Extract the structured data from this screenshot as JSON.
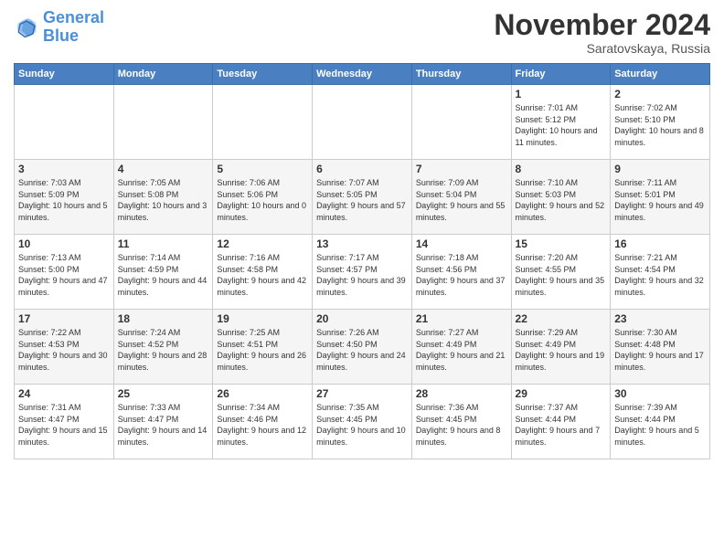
{
  "header": {
    "logo_line1": "General",
    "logo_line2": "Blue",
    "month": "November 2024",
    "location": "Saratovskaya, Russia"
  },
  "weekdays": [
    "Sunday",
    "Monday",
    "Tuesday",
    "Wednesday",
    "Thursday",
    "Friday",
    "Saturday"
  ],
  "weeks": [
    [
      {
        "day": "",
        "info": ""
      },
      {
        "day": "",
        "info": ""
      },
      {
        "day": "",
        "info": ""
      },
      {
        "day": "",
        "info": ""
      },
      {
        "day": "",
        "info": ""
      },
      {
        "day": "1",
        "info": "Sunrise: 7:01 AM\nSunset: 5:12 PM\nDaylight: 10 hours and 11 minutes."
      },
      {
        "day": "2",
        "info": "Sunrise: 7:02 AM\nSunset: 5:10 PM\nDaylight: 10 hours and 8 minutes."
      }
    ],
    [
      {
        "day": "3",
        "info": "Sunrise: 7:03 AM\nSunset: 5:09 PM\nDaylight: 10 hours and 5 minutes."
      },
      {
        "day": "4",
        "info": "Sunrise: 7:05 AM\nSunset: 5:08 PM\nDaylight: 10 hours and 3 minutes."
      },
      {
        "day": "5",
        "info": "Sunrise: 7:06 AM\nSunset: 5:06 PM\nDaylight: 10 hours and 0 minutes."
      },
      {
        "day": "6",
        "info": "Sunrise: 7:07 AM\nSunset: 5:05 PM\nDaylight: 9 hours and 57 minutes."
      },
      {
        "day": "7",
        "info": "Sunrise: 7:09 AM\nSunset: 5:04 PM\nDaylight: 9 hours and 55 minutes."
      },
      {
        "day": "8",
        "info": "Sunrise: 7:10 AM\nSunset: 5:03 PM\nDaylight: 9 hours and 52 minutes."
      },
      {
        "day": "9",
        "info": "Sunrise: 7:11 AM\nSunset: 5:01 PM\nDaylight: 9 hours and 49 minutes."
      }
    ],
    [
      {
        "day": "10",
        "info": "Sunrise: 7:13 AM\nSunset: 5:00 PM\nDaylight: 9 hours and 47 minutes."
      },
      {
        "day": "11",
        "info": "Sunrise: 7:14 AM\nSunset: 4:59 PM\nDaylight: 9 hours and 44 minutes."
      },
      {
        "day": "12",
        "info": "Sunrise: 7:16 AM\nSunset: 4:58 PM\nDaylight: 9 hours and 42 minutes."
      },
      {
        "day": "13",
        "info": "Sunrise: 7:17 AM\nSunset: 4:57 PM\nDaylight: 9 hours and 39 minutes."
      },
      {
        "day": "14",
        "info": "Sunrise: 7:18 AM\nSunset: 4:56 PM\nDaylight: 9 hours and 37 minutes."
      },
      {
        "day": "15",
        "info": "Sunrise: 7:20 AM\nSunset: 4:55 PM\nDaylight: 9 hours and 35 minutes."
      },
      {
        "day": "16",
        "info": "Sunrise: 7:21 AM\nSunset: 4:54 PM\nDaylight: 9 hours and 32 minutes."
      }
    ],
    [
      {
        "day": "17",
        "info": "Sunrise: 7:22 AM\nSunset: 4:53 PM\nDaylight: 9 hours and 30 minutes."
      },
      {
        "day": "18",
        "info": "Sunrise: 7:24 AM\nSunset: 4:52 PM\nDaylight: 9 hours and 28 minutes."
      },
      {
        "day": "19",
        "info": "Sunrise: 7:25 AM\nSunset: 4:51 PM\nDaylight: 9 hours and 26 minutes."
      },
      {
        "day": "20",
        "info": "Sunrise: 7:26 AM\nSunset: 4:50 PM\nDaylight: 9 hours and 24 minutes."
      },
      {
        "day": "21",
        "info": "Sunrise: 7:27 AM\nSunset: 4:49 PM\nDaylight: 9 hours and 21 minutes."
      },
      {
        "day": "22",
        "info": "Sunrise: 7:29 AM\nSunset: 4:49 PM\nDaylight: 9 hours and 19 minutes."
      },
      {
        "day": "23",
        "info": "Sunrise: 7:30 AM\nSunset: 4:48 PM\nDaylight: 9 hours and 17 minutes."
      }
    ],
    [
      {
        "day": "24",
        "info": "Sunrise: 7:31 AM\nSunset: 4:47 PM\nDaylight: 9 hours and 15 minutes."
      },
      {
        "day": "25",
        "info": "Sunrise: 7:33 AM\nSunset: 4:47 PM\nDaylight: 9 hours and 14 minutes."
      },
      {
        "day": "26",
        "info": "Sunrise: 7:34 AM\nSunset: 4:46 PM\nDaylight: 9 hours and 12 minutes."
      },
      {
        "day": "27",
        "info": "Sunrise: 7:35 AM\nSunset: 4:45 PM\nDaylight: 9 hours and 10 minutes."
      },
      {
        "day": "28",
        "info": "Sunrise: 7:36 AM\nSunset: 4:45 PM\nDaylight: 9 hours and 8 minutes."
      },
      {
        "day": "29",
        "info": "Sunrise: 7:37 AM\nSunset: 4:44 PM\nDaylight: 9 hours and 7 minutes."
      },
      {
        "day": "30",
        "info": "Sunrise: 7:39 AM\nSunset: 4:44 PM\nDaylight: 9 hours and 5 minutes."
      }
    ]
  ]
}
